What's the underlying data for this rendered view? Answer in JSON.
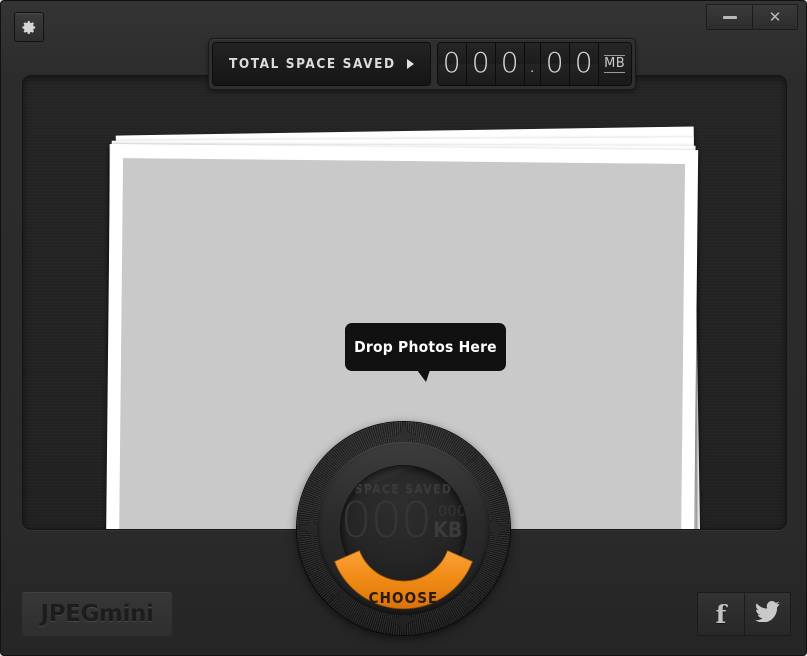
{
  "app": {
    "name": "JPEGmini",
    "brand_label": "JPEGmini",
    "accent_color": "#F28C17",
    "window_background": "#2b2b2b",
    "panel_background": "#232323"
  },
  "titlebar": {
    "settings_icon": "gear-icon",
    "settings_tooltip": "Settings",
    "minimize_label": "–",
    "minimize_icon": "minimize-icon",
    "close_label": "✕",
    "close_icon": "close-icon"
  },
  "total_saved": {
    "label": "TOTAL SPACE SAVED",
    "expand_icon": "triangle-right-icon",
    "digits": [
      "0",
      "0",
      "0",
      ".",
      "0",
      "0"
    ],
    "value": "000.00",
    "unit": "MB"
  },
  "drop_area": {
    "tooltip": "Drop Photos Here",
    "photo_count": 4,
    "photo_frame_color": "#ffffff",
    "photo_fill_color": "#c9c9c9"
  },
  "dial": {
    "readout_label": "SPACE SAVED",
    "value_integer": "000",
    "value_fraction": ".000",
    "unit": "KB",
    "action_label": "CHOOSE",
    "action_color": "#F28C17"
  },
  "footer": {
    "brand": "JPEGmini",
    "social": [
      {
        "name": "facebook-icon",
        "label": "f"
      },
      {
        "name": "twitter-icon",
        "label": ""
      }
    ]
  }
}
